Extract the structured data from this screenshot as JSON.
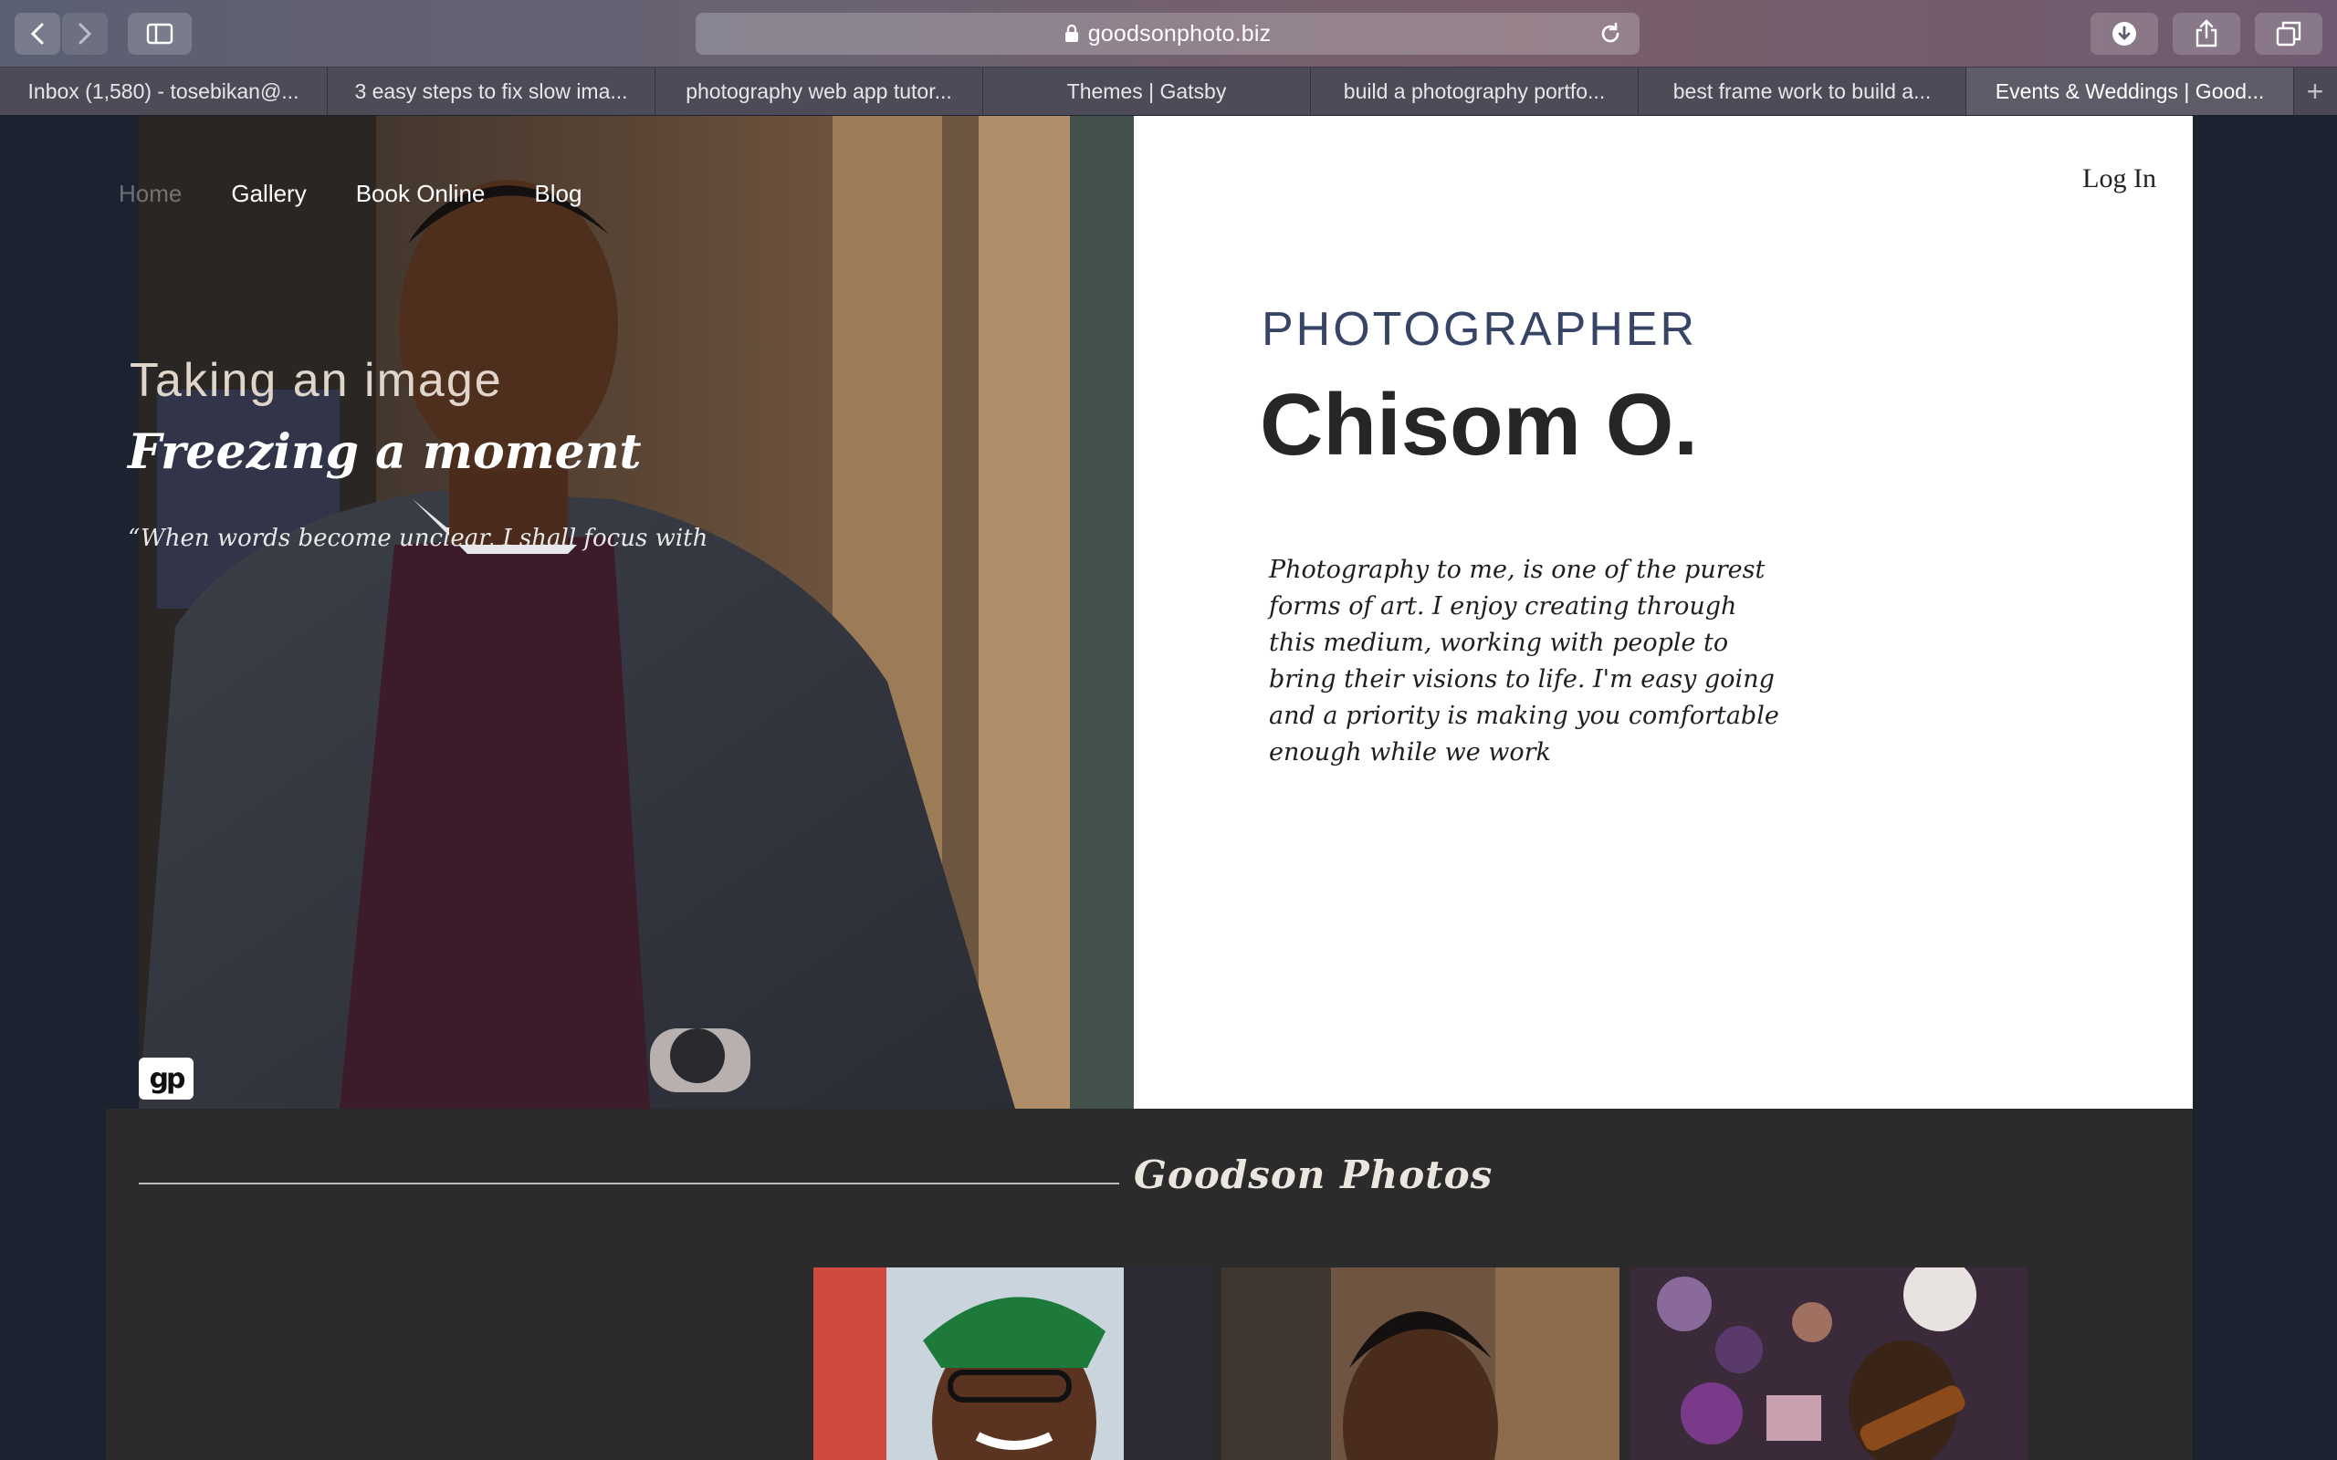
{
  "browser": {
    "url": "goodsonphoto.biz",
    "tabs": [
      {
        "label": "Inbox (1,580) - tosebikan@...",
        "active": false
      },
      {
        "label": "3 easy steps to fix slow ima...",
        "active": false
      },
      {
        "label": "photography web app tutor...",
        "active": false
      },
      {
        "label": "Themes | Gatsby",
        "active": false
      },
      {
        "label": "build a photography portfo...",
        "active": false
      },
      {
        "label": "best frame work to build a...",
        "active": false
      },
      {
        "label": "Events & Weddings | Good...",
        "active": true
      }
    ],
    "new_tab_label": "+"
  },
  "site": {
    "nav": {
      "home": "Home",
      "gallery": "Gallery",
      "book_online": "Book Online",
      "blog": "Blog"
    },
    "login": "Log In",
    "logo_text": "gp",
    "hero": {
      "role": "PHOTOGRAPHER",
      "name": "Chisom O.",
      "bio": "Photography to me, is one of the purest forms of art. I enjoy creating through this medium, working with people to bring their visions to life. I'm easy going and a priority is making you comfortable enough while we work"
    },
    "section": {
      "title": "Goodson Photos",
      "tagline_1": "Taking an image",
      "tagline_2": "Freezing a moment",
      "quote": "“When words become unclear, I shall focus with"
    }
  },
  "colors": {
    "page_bg": "#1c2230",
    "role_text": "#364566",
    "section_bg": "#2b2b2b",
    "tagline_1": "#e0d5ca"
  },
  "icons": [
    "back-icon",
    "forward-icon",
    "sidebar-icon",
    "lock-icon",
    "reload-icon",
    "download-icon",
    "share-icon",
    "tabs-overview-icon"
  ]
}
